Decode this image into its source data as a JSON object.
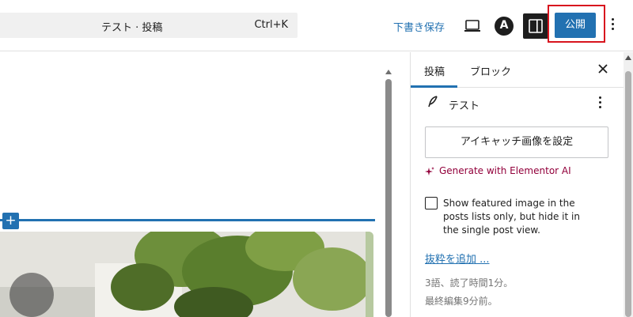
{
  "header": {
    "doc_title": "テスト · 投稿",
    "shortcut": "Ctrl+K",
    "save_draft": "下書き保存",
    "publish": "公開",
    "astra_letter": "A"
  },
  "icons": {
    "preview": "laptop-icon",
    "astra": "astra-logo-icon",
    "settings": "sidebar-toggle-icon",
    "options": "vertical-ellipsis-icon",
    "close": "close-icon",
    "post": "feather-icon",
    "ai": "sparkle-icon",
    "insert": "plus-icon"
  },
  "canvas": {
    "inserter_label": "+"
  },
  "sidebar": {
    "tabs": [
      {
        "label": "投稿",
        "active": true
      },
      {
        "label": "ブロック",
        "active": false
      }
    ],
    "post_name": "テスト",
    "featured_button": "アイキャッチ画像を設定",
    "elementor_ai": "Generate with Elementor AI",
    "checkbox_label": "Show featured image in the posts lists only, but hide it in the single post view.",
    "checkbox_checked": false,
    "excerpt_link": "抜粋を追加 ...",
    "word_count": "3語、読了時間1分。",
    "last_edited": "最終編集9分前。"
  },
  "colors": {
    "accent": "#2271b1",
    "highlight_outline": "#d8141e",
    "elementor": "#92003b"
  }
}
